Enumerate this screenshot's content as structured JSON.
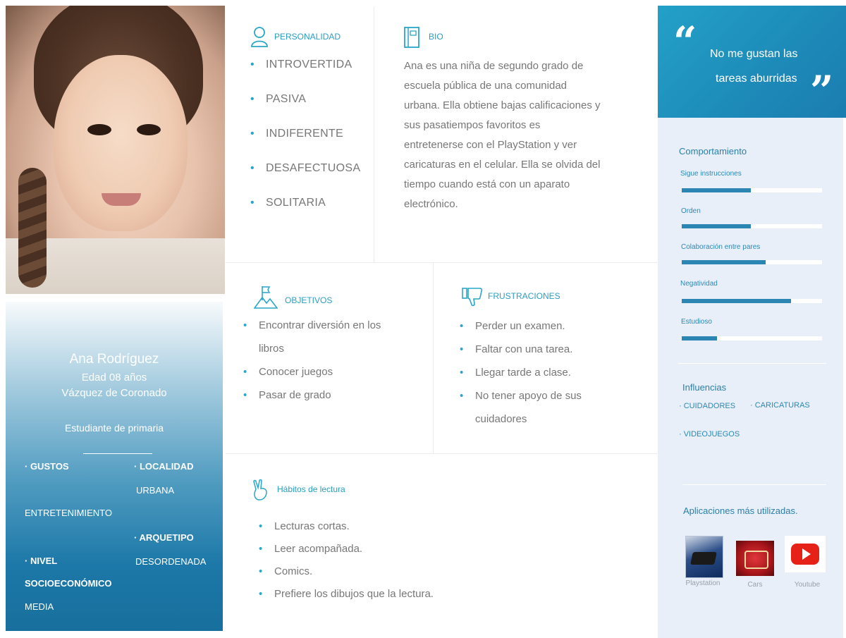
{
  "profile": {
    "name": "Ana Rodríguez",
    "age": "Edad 08 años",
    "location": "Vázquez de Coronado",
    "occupation": "Estudiante de primaria",
    "gustos_label": "· GUSTOS",
    "gustos_value": "ENTRETENIMIENTO",
    "localidad_label": "· LOCALIDAD",
    "localidad_value": "URBANA",
    "arquetipo_label": "· ARQUETIPO",
    "arquetipo_value": "DESORDENADA",
    "nivel_label_1": "· NIVEL",
    "nivel_label_2": "SOCIOECONÓMICO",
    "nivel_value": "MEDIA"
  },
  "personalidad": {
    "title": "PERSONALIDAD",
    "items": [
      "INTROVERTIDA",
      "PASIVA",
      "INDIFERENTE",
      "DESAFECTUOSA",
      "SOLITARIA"
    ]
  },
  "bio": {
    "title": "BIO",
    "lines": [
      "Ana es una niña de segundo grado de",
      "escuela pública de una comunidad",
      "urbana. Ella obtiene bajas calificaciones y",
      "sus  pasatiempos favoritos es",
      "entretenerse con el PlayStation y ver",
      "caricaturas en el celular. Ella se olvida del",
      "tiempo cuando está con un aparato",
      "electrónico."
    ]
  },
  "objetivos": {
    "title": "OBJETIVOS",
    "item1_line1": "Encontrar diversión en los",
    "item1_line2": "libros",
    "item2": "Conocer juegos",
    "item3": "Pasar de grado"
  },
  "frustraciones": {
    "title": "FRUSTRACIONES",
    "item1": "Perder un examen.",
    "item2": "Faltar con una tarea.",
    "item3": "Llegar tarde a clase.",
    "item4_line1": "No tener apoyo de sus",
    "item4_line2": "cuidadores"
  },
  "habitos": {
    "title": "Hábitos de lectura",
    "items": [
      "Lecturas cortas.",
      "Leer acompañada.",
      "Comics.",
      "Prefiere los dibujos que la lectura."
    ]
  },
  "quote": {
    "line1": "No me gustan las",
    "line2": "tareas aburridas",
    "open_mark": "“",
    "close_mark": "”"
  },
  "comportamiento": {
    "title": "Comportamiento",
    "bars": [
      {
        "label": "Sigue instrucciones",
        "value": 0.49
      },
      {
        "label": "Orden",
        "value": 0.49
      },
      {
        "label": "Colaboración entre pares",
        "value": 0.6
      },
      {
        "label": "Negatividad",
        "value": 0.78
      },
      {
        "label": "Estudioso",
        "value": 0.25
      }
    ]
  },
  "influencias": {
    "title": "Influencias",
    "items": [
      "· CUIDADORES",
      "· CARICATURAS",
      "· VIDEOJUEGOS"
    ]
  },
  "aplicaciones": {
    "title": "Aplicaciones más utilizadas.",
    "apps": [
      "Playstation",
      "Cars",
      "Youtube"
    ]
  },
  "colors": {
    "accent": "#2a9ec1",
    "quote_bg": "#1d8ab8",
    "bar": "#2c86b3",
    "right_bg": "#e9eff9"
  },
  "icons": [
    "person-icon",
    "book-icon",
    "flag-mountain-icon",
    "thumbs-down-icon",
    "peace-hand-icon",
    "quote-icon"
  ]
}
